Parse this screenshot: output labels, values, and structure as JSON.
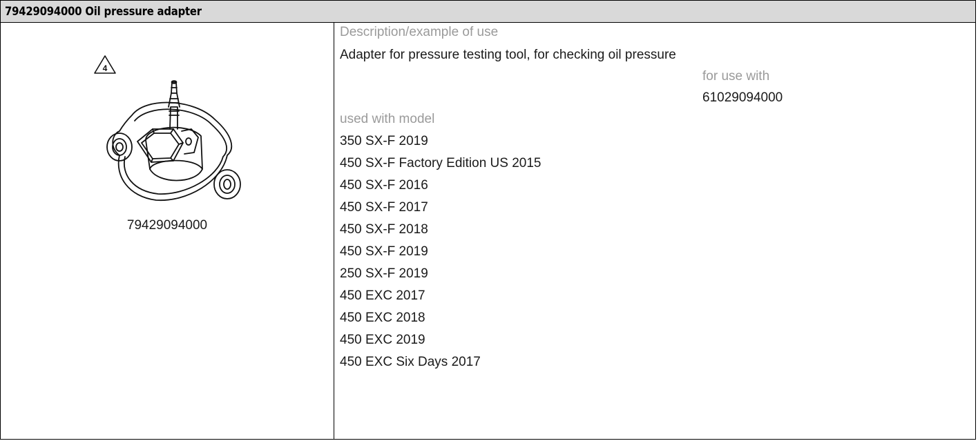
{
  "header": {
    "title": "79429094000 Oil pressure adapter"
  },
  "figure": {
    "warning_number": "4",
    "part_number": "79429094000"
  },
  "details": {
    "description_label": "Description/example of use",
    "description": "Adapter for pressure testing tool, for checking oil pressure",
    "use_with_label": "for use with",
    "use_with_value": "61029094000",
    "models_label": "used with model",
    "models": [
      "350 SX-F 2019",
      "450 SX-F Factory Edition US 2015",
      "450 SX-F 2016",
      "450 SX-F 2017",
      "450 SX-F 2018",
      "450 SX-F 2019",
      "250 SX-F 2019",
      "450 EXC 2017",
      "450 EXC 2018",
      "450 EXC 2019",
      "450 EXC Six Days 2017"
    ]
  }
}
